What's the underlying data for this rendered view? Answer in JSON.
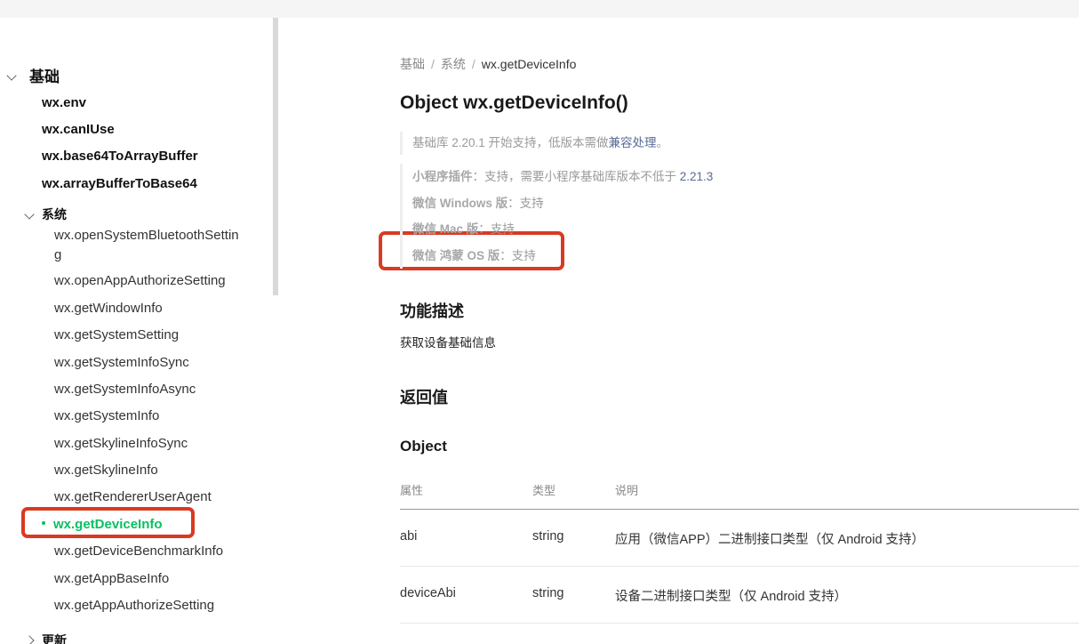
{
  "sidebar": {
    "section_base": "基础",
    "top_items": [
      "wx.env",
      "wx.canIUse",
      "wx.base64ToArrayBuffer",
      "wx.arrayBufferToBase64"
    ],
    "section_system": "系统",
    "system_items": [
      "wx.openSystemBluetoothSetting",
      "wx.openAppAuthorizeSetting",
      "wx.getWindowInfo",
      "wx.getSystemSetting",
      "wx.getSystemInfoSync",
      "wx.getSystemInfoAsync",
      "wx.getSystemInfo",
      "wx.getSkylineInfoSync",
      "wx.getSkylineInfo",
      "wx.getRendererUserAgent",
      "wx.getDeviceInfo",
      "wx.getDeviceBenchmarkInfo",
      "wx.getAppBaseInfo",
      "wx.getAppAuthorizeSetting"
    ],
    "active_item": "wx.getDeviceInfo",
    "section_update": "更新"
  },
  "main": {
    "breadcrumb": [
      "基础",
      "系统",
      "wx.getDeviceInfo"
    ],
    "title": "Object wx.getDeviceInfo()",
    "support_note": {
      "prefix": "基础库 2.20.1 开始支持，低版本需做",
      "link": "兼容处理",
      "suffix": "。"
    },
    "platform_support": [
      {
        "key": "小程序插件",
        "value": "：支持，需要小程序基础库版本不低于 ",
        "version": "2.21.3"
      },
      {
        "key": "微信 Windows 版",
        "value": "：支持",
        "version": ""
      },
      {
        "key": "微信 Mac 版",
        "value": "：支持",
        "version": ""
      },
      {
        "key": "微信 鸿蒙 OS 版",
        "value": "：支持",
        "version": ""
      }
    ],
    "feature_heading": "功能描述",
    "feature_desc": "获取设备基础信息",
    "return_heading": "返回值",
    "object_heading": "Object",
    "table": {
      "headers": [
        "属性",
        "类型",
        "说明"
      ],
      "rows": [
        [
          "abi",
          "string",
          "应用（微信APP）二进制接口类型（仅 Android 支持）"
        ],
        [
          "deviceAbi",
          "string",
          "设备二进制接口类型（仅 Android 支持）"
        ]
      ]
    }
  },
  "colors": {
    "active": "#07c160",
    "highlight": "#d93a22",
    "link": "#576b95"
  }
}
